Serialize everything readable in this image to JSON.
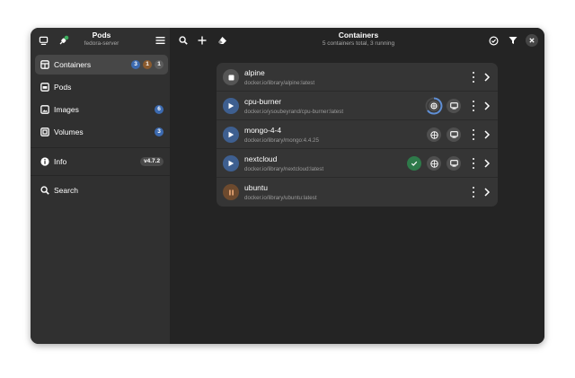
{
  "sidebar": {
    "app_title": "Pods",
    "connection": "fedora-server",
    "nav": [
      {
        "label": "Containers",
        "icon": "containers-icon",
        "badges": [
          "3",
          "1",
          "1"
        ]
      },
      {
        "label": "Pods",
        "icon": "pods-icon"
      },
      {
        "label": "Images",
        "icon": "images-icon",
        "badge": "6"
      },
      {
        "label": "Volumes",
        "icon": "volumes-icon",
        "badge": "3"
      },
      {
        "label": "Info",
        "icon": "info-icon",
        "badge": "v4.7.2"
      },
      {
        "label": "Search",
        "icon": "search-icon"
      }
    ]
  },
  "header": {
    "title": "Containers",
    "subtitle": "5 containers total, 3 running"
  },
  "containers": [
    {
      "name": "alpine",
      "image": "docker.io/library/alpine:latest",
      "status": "stopped"
    },
    {
      "name": "cpu-burner",
      "image": "docker.io/ysoubeyrand/cpu-burner:latest",
      "status": "running"
    },
    {
      "name": "mongo-4-4",
      "image": "docker.io/library/mongo:4.4.25",
      "status": "running"
    },
    {
      "name": "nextcloud",
      "image": "docker.io/library/nextcloud:latest",
      "status": "running",
      "healthy": true
    },
    {
      "name": "ubuntu",
      "image": "docker.io/library/ubuntu:latest",
      "status": "paused"
    }
  ],
  "colors": {
    "sidebar_bg": "#303030",
    "main_bg": "#242424",
    "list_bg": "#353535",
    "running": "#3e5f90",
    "paused": "#6d4a2e",
    "healthy": "#2e7a4a",
    "badge_blue": "#3c6ab0"
  }
}
